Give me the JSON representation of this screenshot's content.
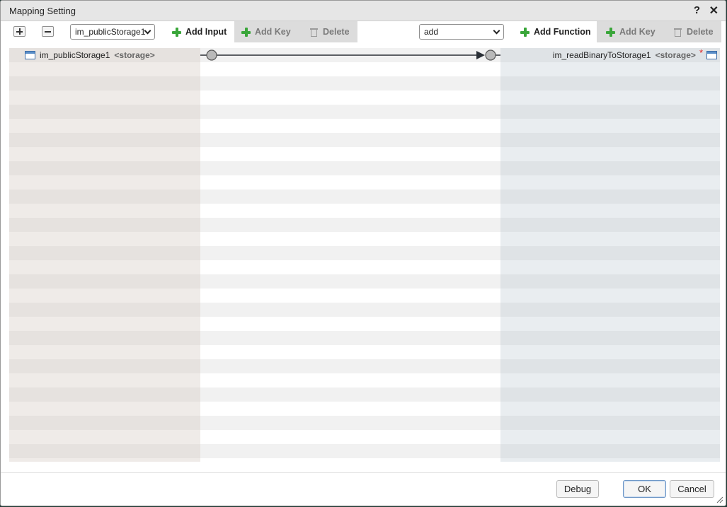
{
  "dialog": {
    "title": "Mapping Setting",
    "help_label": "?",
    "close_label": "✕"
  },
  "left_toolbar": {
    "source_select_value": "im_publicStorage1",
    "add_input_label": "Add Input",
    "add_key_label": "Add Key",
    "delete_label": "Delete"
  },
  "right_toolbar": {
    "function_select_value": "add",
    "add_function_label": "Add Function",
    "add_key_label": "Add Key",
    "delete_label": "Delete"
  },
  "source_node": {
    "name": "im_publicStorage1",
    "type": "<storage>",
    "icon": "window-icon"
  },
  "target_node": {
    "name": "im_readBinaryToStorage1",
    "type": "<storage>",
    "required_marker": "*",
    "icon": "window-icon"
  },
  "footer": {
    "debug_label": "Debug",
    "ok_label": "OK",
    "cancel_label": "Cancel"
  },
  "colors": {
    "add_icon": "#3aa63a",
    "required_marker": "#e02020",
    "source_column": "#e6e2df",
    "target_column": "#dfe3e6"
  }
}
